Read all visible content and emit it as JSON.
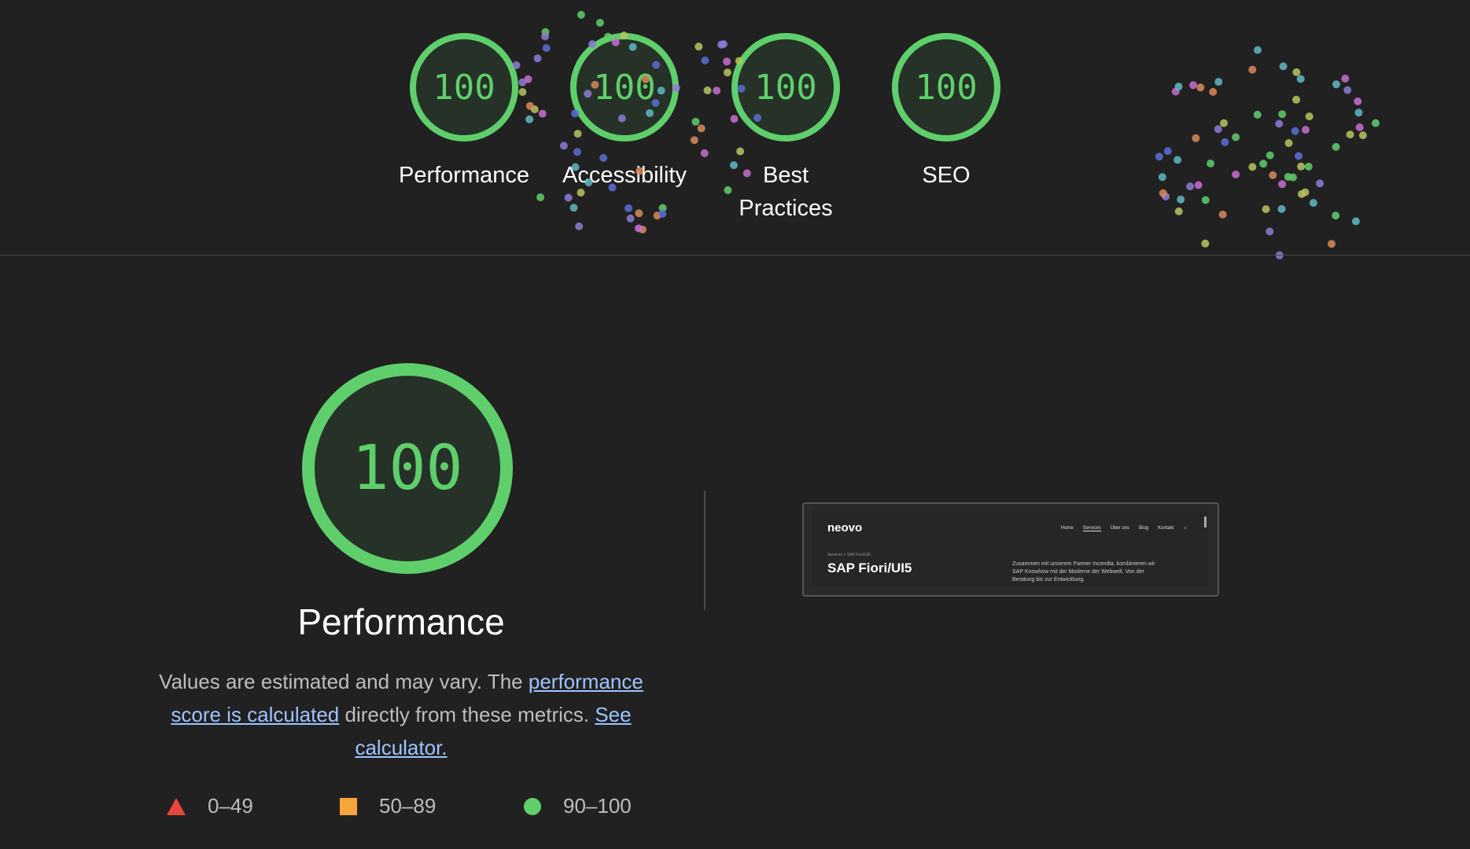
{
  "summary_gauges": [
    {
      "score": "100",
      "label": "Performance"
    },
    {
      "score": "100",
      "label": "Accessibility"
    },
    {
      "score": "100",
      "label": "Best\nPractices"
    },
    {
      "score": "100",
      "label": "SEO"
    }
  ],
  "category": {
    "score": "100",
    "title": "Performance",
    "desc_prefix": "Values are estimated and may vary. The ",
    "link_score": "performance score is calculated",
    "desc_middle": " directly from these metrics. ",
    "link_calculator": "See calculator."
  },
  "legend": [
    {
      "shape": "triangle",
      "range": "0–49",
      "color": "#e8453c"
    },
    {
      "shape": "square",
      "range": "50–89",
      "color": "#f4a63b"
    },
    {
      "shape": "circle",
      "range": "90–100",
      "color": "#5fcf6b"
    }
  ],
  "thumbnail": {
    "logo": "neovo",
    "nav": [
      "Home",
      "Services",
      "Über uns",
      "Blog",
      "Kontakt"
    ],
    "breadcrumb": "Services  >  SAP Fiori/UI5",
    "heading": "SAP Fiori/UI5",
    "text": "Zusammen mit unserem Partner Incendia, kombinieren wir SAP Knowhow mit der Moderne der Webwelt. Von der Beratung bis zur Entwicklung."
  },
  "colors": {
    "pass": "#5fcf6b",
    "pass_bg": "#263227",
    "background": "#212121",
    "link": "#9ec3ff"
  }
}
